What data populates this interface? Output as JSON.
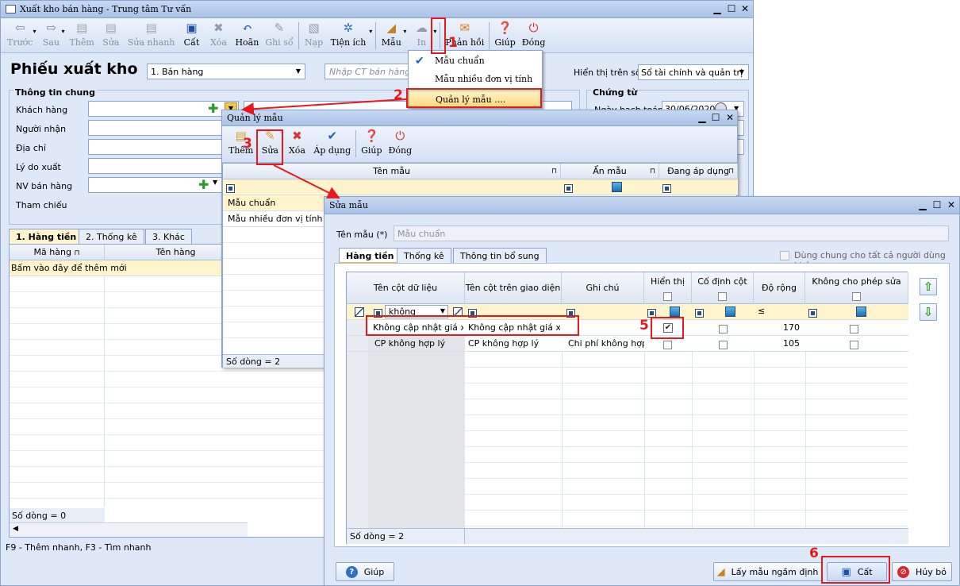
{
  "main": {
    "title": "Xuất kho bán hàng - Trung tâm Tư vấn",
    "toolbar": [
      "Trước",
      "Sau",
      "Thêm",
      "Sửa",
      "Sửa nhanh",
      "Cất",
      "Xóa",
      "Hoãn",
      "Ghi sổ",
      "Nạp",
      "Tiện ích",
      "Mẫu",
      "In",
      "Phản hồi",
      "Giúp",
      "Đóng"
    ],
    "heading": "Phiếu xuất kho",
    "type_value": "1. Bán hàng",
    "ct_placeholder": "Nhập CT bán hàng",
    "display_label": "Hiển thị trên sổ",
    "display_value": "Sổ tài chính và quản trị",
    "section_general": "Thông tin chung",
    "fields": [
      "Khách hàng",
      "Người nhận",
      "Địa chỉ",
      "Lý do xuất",
      "NV bán hàng",
      "Tham chiếu"
    ],
    "section_voucher": "Chứng từ",
    "date_label": "Ngày hạch toán",
    "date_value": "30/06/2020",
    "tabs": [
      "1. Hàng tiền",
      "2. Thống kê",
      "3. Khác"
    ],
    "grid_headers": [
      "Mã hàng",
      "Tên hàng"
    ],
    "grid_add_row": "Bấm vào đây để thêm mới",
    "row_count": "Số dòng = 0",
    "status": "F9 - Thêm nhanh, F3 - Tìm nhanh"
  },
  "menu": {
    "items": [
      "Mẫu chuẩn",
      "Mẫu nhiều đơn vị tính",
      "Quản lý mẫu ...."
    ]
  },
  "ql": {
    "title": "Quản lý mẫu",
    "toolbar": [
      "Thêm",
      "Sửa",
      "Xóa",
      "Áp dụng",
      "Giúp",
      "Đóng"
    ],
    "headers": [
      "Tên mẫu",
      "Ẩn mẫu",
      "Đang áp dụng"
    ],
    "rows": [
      "Mẫu chuẩn",
      "Mẫu nhiều đơn vị tính"
    ],
    "row_count": "Số dòng = 2"
  },
  "sm": {
    "title": "Sửa mẫu",
    "name_label": "Tên mẫu (*)",
    "name_value": "Mẫu chuẩn",
    "tabs": [
      "Hàng tiền",
      "Thống kê",
      "Thông tin bổ sung"
    ],
    "share_label": "Dùng chung cho tất cả người dùng khác",
    "headers": [
      "Tên cột dữ liệu",
      "Tên cột trên giao diện",
      "Ghi chú",
      "Hiển thị",
      "Cố định cột",
      "Độ rộng",
      "Không cho phép sửa"
    ],
    "filter_value": "không",
    "filter_op": "≤",
    "rows": [
      {
        "data_col": "Không cập nhật giá x",
        "ui_col": "Không cập nhật giá xu",
        "note": "",
        "show": true,
        "width": "170"
      },
      {
        "data_col": "CP không hợp lý",
        "ui_col": "CP không hợp lý",
        "note": "Chi phí không hợp",
        "show": false,
        "width": "105"
      }
    ],
    "row_count": "Số dòng = 2",
    "btn_help": "Giúp",
    "btn_default": "Lấy mẫu ngầm định",
    "btn_save": "Cất",
    "btn_cancel": "Hủy bỏ"
  },
  "steps": [
    "1",
    "2",
    "3",
    "5",
    "6"
  ],
  "colors": {
    "highlight": "#e8191c",
    "row_yellow": "#fff4cc",
    "frame": "#dfe8f6"
  }
}
